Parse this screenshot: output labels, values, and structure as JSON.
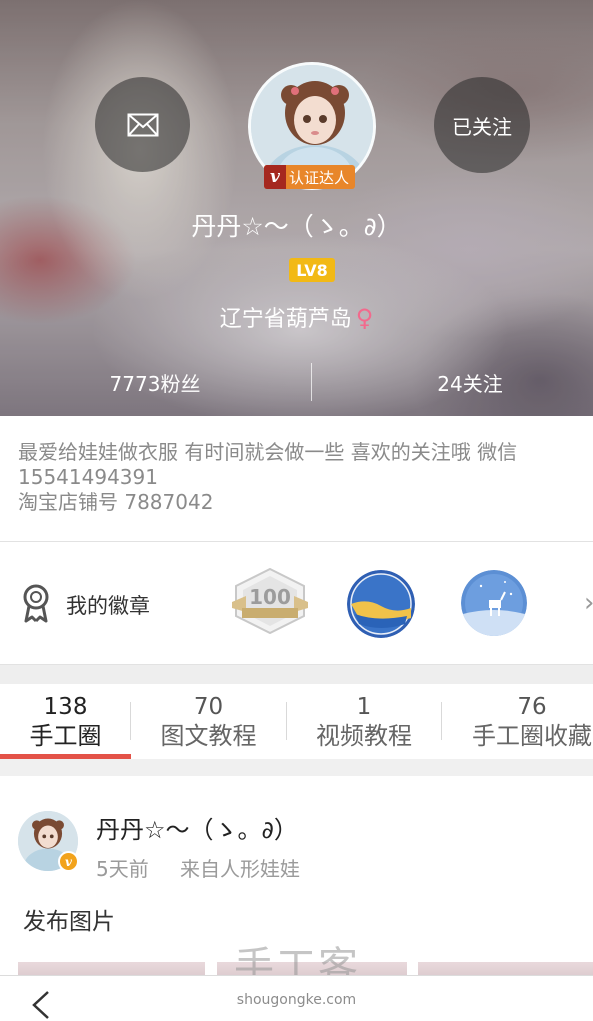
{
  "profile": {
    "follow_button_label": "已关注",
    "cert_badge_label": "认证达人",
    "cert_badge_letter": "v",
    "nickname": "丹丹☆～（ゝ。∂）",
    "level": "LV8",
    "location": "辽宁省葫芦岛",
    "gender_symbol": "♀",
    "fans": "7773粉丝",
    "following": "24关注"
  },
  "bio": {
    "line1": "最爱给娃娃做衣服 有时间就会做一些 喜欢的关注哦  微信",
    "line2": "15541494391",
    "line3": "淘宝店铺号 7887042"
  },
  "badges": {
    "label": "我的徽章",
    "items": [
      {
        "icon": "badge-100-icon",
        "text": "100"
      },
      {
        "icon": "badge-sea-icon"
      },
      {
        "icon": "badge-night-deer-icon"
      }
    ]
  },
  "tabs": [
    {
      "count": "138",
      "label": "手工圈",
      "active": true
    },
    {
      "count": "70",
      "label": "图文教程"
    },
    {
      "count": "1",
      "label": "视频教程"
    },
    {
      "count": "76",
      "label": "手工圈收藏"
    }
  ],
  "post": {
    "author": "丹丹☆～（ゝ。∂）",
    "time": "5天前",
    "source": "来自人形娃娃",
    "text": "发布图片"
  },
  "watermark": {
    "text": "手工客",
    "url": "shougongke.com"
  },
  "colors": {
    "accent_red": "#e35248",
    "level_yellow": "#f2b915",
    "cert_orange": "#e8862a",
    "female_pink": "#f26a8d"
  }
}
